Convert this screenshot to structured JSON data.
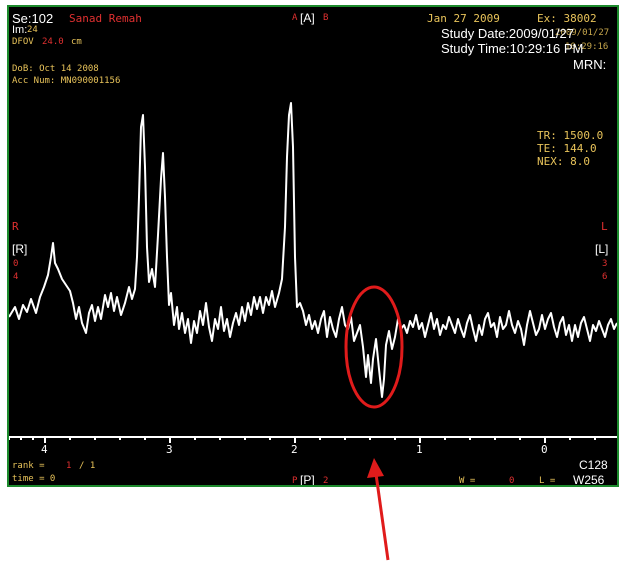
{
  "header_left": {
    "series": "Se:102",
    "patient_name": "Sanad Remah",
    "image_label": "Im:",
    "image_num": "24",
    "dfov_label": "DFOV",
    "dfov_value": "24.0",
    "dfov_unit": "cm",
    "dob": "DoB: Oct 14 2008",
    "acc_num": "Acc Num: MN090001156"
  },
  "header_center": {
    "left_marker": "A",
    "orientation": "[A]",
    "right_marker": "B"
  },
  "header_right": {
    "date": "Jan 27 2009",
    "exam": "Ex: 38002",
    "study_date": "Study Date:2009/01/27",
    "study_time": "Study Time:10:29:16 PM",
    "mrn": "MRN:",
    "ghost_date": "2009/01/27",
    "ghost_time": "10:29:16"
  },
  "params": {
    "tr": "TR: 1500.0",
    "te": "TE: 144.0",
    "nex": "NEX: 8.0"
  },
  "side_left": {
    "letter": "R",
    "bracket": "[R]",
    "num1": "0",
    "num2": "4"
  },
  "side_right": {
    "letter": "L",
    "bracket": "[L]",
    "num1": "3",
    "num2": "6"
  },
  "axis": {
    "ticks": [
      "4",
      "3",
      "2",
      "1",
      "0"
    ]
  },
  "footer": {
    "rank_label": "rank =",
    "rank_value": "1",
    "rank_total": "/ 1",
    "time": "time = 0",
    "bottom_left_marker": "P",
    "bottom_orientation": "[P]",
    "bottom_right_marker": "2",
    "w_label": "W =",
    "w_value": "0",
    "l_label": "L =",
    "c_value": "C128",
    "w_window": "W256"
  },
  "colors": {
    "frame_border": "#1c8a2c",
    "annotation": "#e01b1b",
    "overlay_yellow": "#e8c35a",
    "overlay_red": "#e03030",
    "trace": "#ffffff"
  },
  "icons": {
    "highlight": "circle",
    "pointer": "up-arrow"
  }
}
